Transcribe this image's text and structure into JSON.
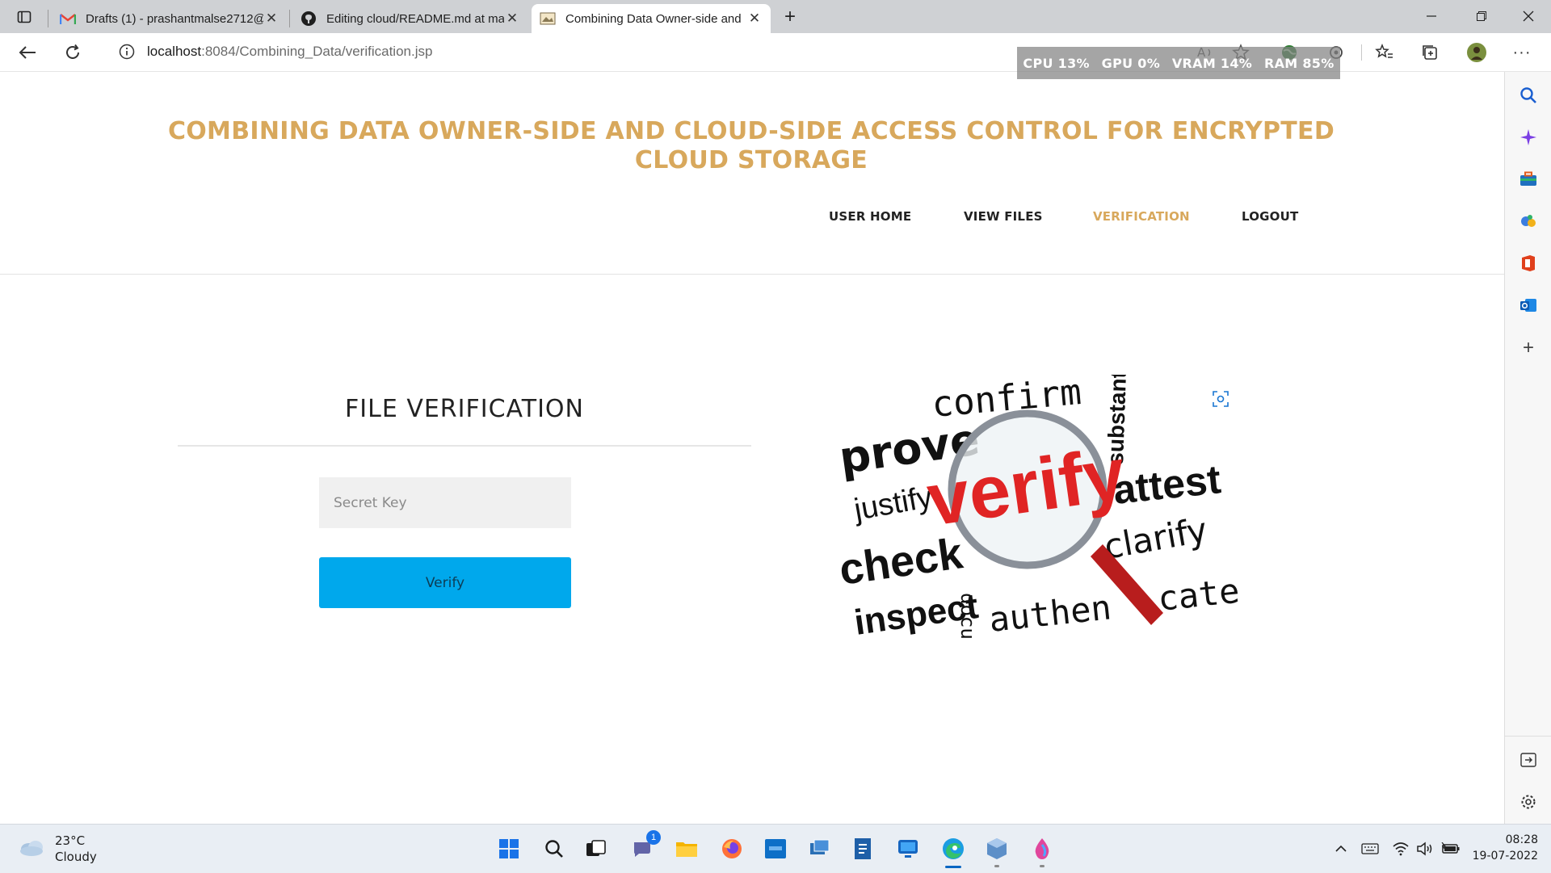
{
  "browser": {
    "tabs": [
      {
        "label": "Drafts (1) - prashantmalse2712@",
        "favicon": "gmail-icon",
        "active": false
      },
      {
        "label": "Editing cloud/README.md at ma",
        "favicon": "github-icon",
        "active": false
      },
      {
        "label": "Combining Data Owner-side and",
        "favicon": "site-icon",
        "active": true
      }
    ],
    "address": {
      "host": "localhost",
      "path": ":8084/Combining_Data/verification.jsp"
    },
    "perf": {
      "cpu": "CPU  13%",
      "gpu": "GPU   0%",
      "vram": "VRAM  14%",
      "ram": "RAM  85%"
    }
  },
  "site": {
    "title": "COMBINING DATA OWNER-SIDE AND CLOUD-SIDE ACCESS CONTROL FOR ENCRYPTED CLOUD STORAGE",
    "nav": [
      {
        "label": "USER HOME"
      },
      {
        "label": "VIEW FILES"
      },
      {
        "label": "VERIFICATION",
        "active": true
      },
      {
        "label": "LOGOUT"
      }
    ]
  },
  "form": {
    "heading": "FILE VERIFICATION",
    "secret_key_placeholder": "Secret Key",
    "secret_key_value": "",
    "verify_label": "Verify"
  },
  "image_words": {
    "confirm": "confirm",
    "substantiate": "substantiat",
    "prove": "prove",
    "justify": "justify",
    "verify": "verify",
    "attest": "attest",
    "check": "check",
    "clarify": "clarify",
    "inspect": "inspect",
    "document": "docu",
    "authen": "authen",
    "cate": "cate"
  },
  "taskbar": {
    "weather": {
      "temp": "23°C",
      "condition": "Cloudy"
    },
    "chat_badge": "1",
    "clock": {
      "time": "08:28",
      "date": "19-07-2022"
    }
  },
  "colors": {
    "accent_gold": "#d8a85c",
    "verify_button": "#00a8ec",
    "input_bg": "#f0f0f0"
  }
}
